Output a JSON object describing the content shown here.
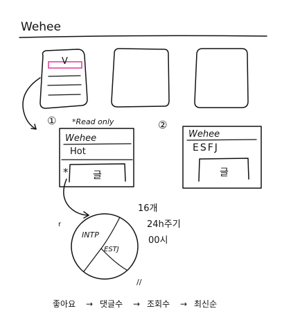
{
  "title": "Wehee",
  "wireframe_cards": {
    "first_card_check": "V"
  },
  "flow_labels": {
    "step_one_marker": "①",
    "step_two_marker": "②",
    "read_only_note": "*Read only",
    "star_marker": "*"
  },
  "screen_one": {
    "app_name": "Wehee",
    "subtitle": "Hot",
    "button_label": "글"
  },
  "screen_two": {
    "app_name": "Wehee",
    "subtitle": "ESFJ",
    "button_label": "글"
  },
  "pie": {
    "prefix_mark": "r",
    "slice_labels": [
      "INTP",
      "ESTJ"
    ],
    "equals_mark": "//"
  },
  "notes": {
    "lines": [
      "16개",
      "24h주기",
      "00시"
    ]
  },
  "sort_order": {
    "items": [
      "좋아요",
      "댓글수",
      "조회수",
      "최신순"
    ],
    "arrow": "→"
  },
  "colors": {
    "ink": "#111111",
    "highlight": "#e0389a"
  }
}
